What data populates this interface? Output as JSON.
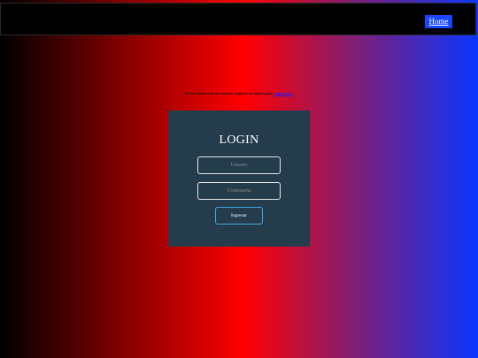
{
  "nav": {
    "home_label": "Home"
  },
  "register": {
    "message": "Si no cuenta con un usuario, ingrese al enlace para",
    "link_label": "registrarse"
  },
  "login": {
    "title": "LOGIN",
    "username_placeholder": "Usuario",
    "password_placeholder": "Contraseña",
    "submit_label": "Ingresar"
  },
  "colors": {
    "gradient": [
      "#000000",
      "#ff0000",
      "#0a36ff"
    ],
    "card_bg": "#253c4c",
    "home_button_bg": "#1646ff",
    "submit_border": "#4aa3e0"
  }
}
